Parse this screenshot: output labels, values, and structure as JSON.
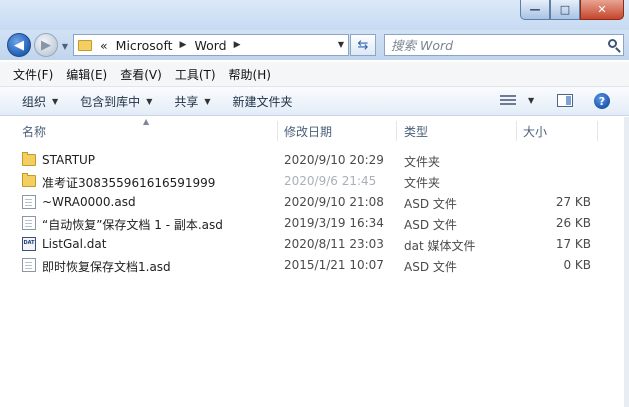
{
  "address": {
    "chevron": "«",
    "crumbs": [
      "Microsoft",
      "Word"
    ],
    "refresh_icon": "refresh-arrows-icon"
  },
  "search": {
    "placeholder": "搜索 Word"
  },
  "menu": [
    "文件(F)",
    "编辑(E)",
    "查看(V)",
    "工具(T)",
    "帮助(H)"
  ],
  "commands": {
    "organize": "组织",
    "include_library": "包含到库中",
    "share": "共享",
    "new_folder": "新建文件夹"
  },
  "columns": {
    "name": "名称",
    "date": "修改日期",
    "type": "类型",
    "size": "大小"
  },
  "files": [
    {
      "name": "STARTUP",
      "date": "2020/9/10 20:29",
      "type": "文件夹",
      "size": "",
      "icon": "folder-icon"
    },
    {
      "name": "准考证308355961616591999",
      "date": "2020/9/6 21:45",
      "type": "文件夹",
      "size": "",
      "icon": "folder-icon"
    },
    {
      "name": "~WRA0000.asd",
      "date": "2020/9/10 21:08",
      "type": "ASD 文件",
      "size": "27 KB",
      "icon": "document-icon"
    },
    {
      "name": "“自动恢复”保存文档 1 - 副本.asd",
      "date": "2019/3/19 16:34",
      "type": "ASD 文件",
      "size": "26 KB",
      "icon": "document-icon"
    },
    {
      "name": "ListGal.dat",
      "date": "2020/8/11 23:03",
      "type": "dat 媒体文件",
      "size": "17 KB",
      "icon": "dat-file-icon"
    },
    {
      "name": "即时恢复保存文档1.asd",
      "date": "2015/1/21 10:07",
      "type": "ASD 文件",
      "size": "0 KB",
      "icon": "document-icon"
    }
  ]
}
